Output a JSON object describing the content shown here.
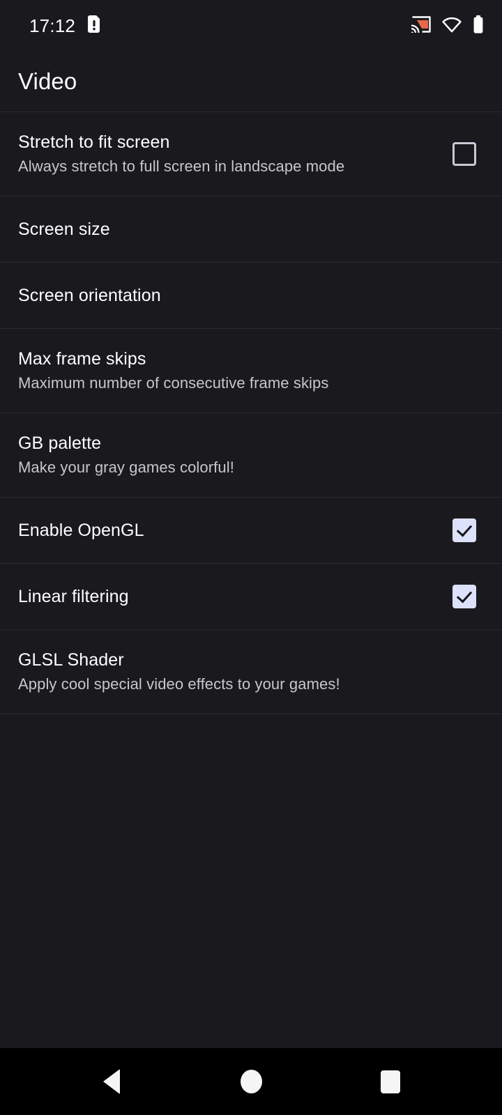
{
  "status_bar": {
    "time": "17:12",
    "left_icons": [
      {
        "name": "sd-card-alert-icon"
      }
    ],
    "right_icons": [
      {
        "name": "cast-icon",
        "color": "#e8674a"
      },
      {
        "name": "wifi-icon",
        "color": "#ffffff"
      },
      {
        "name": "battery-full-icon",
        "color": "#ffffff"
      }
    ]
  },
  "header": {
    "title": "Video"
  },
  "preferences": [
    {
      "title": "Stretch to fit screen",
      "summary": "Always stretch to full screen in landscape mode",
      "control": "checkbox",
      "checked": false
    },
    {
      "title": "Screen size",
      "summary": "",
      "control": "none",
      "checked": null
    },
    {
      "title": "Screen orientation",
      "summary": "",
      "control": "none",
      "checked": null
    },
    {
      "title": "Max frame skips",
      "summary": "Maximum number of consecutive frame skips",
      "control": "none",
      "checked": null
    },
    {
      "title": "GB palette",
      "summary": "Make your gray games colorful!",
      "control": "none",
      "checked": null
    },
    {
      "title": "Enable OpenGL",
      "summary": "",
      "control": "checkbox",
      "checked": true
    },
    {
      "title": "Linear filtering",
      "summary": "",
      "control": "checkbox",
      "checked": true
    },
    {
      "title": "GLSL Shader",
      "summary": "Apply cool special video effects to your games!",
      "control": "none",
      "checked": null
    }
  ],
  "nav_bar": {
    "buttons": [
      {
        "name": "back-button",
        "label": "Back"
      },
      {
        "name": "home-button",
        "label": "Home"
      },
      {
        "name": "recents-button",
        "label": "Recents"
      }
    ]
  },
  "colors": {
    "background": "#1a1a1e",
    "divider": "#2a2a2f",
    "title_text": "#ffffff",
    "summary_text": "#c6c6cc",
    "checkbox_on": "#dde1f9",
    "checkbox_off_border": "#c9c8d4",
    "nav_background": "#000000"
  }
}
